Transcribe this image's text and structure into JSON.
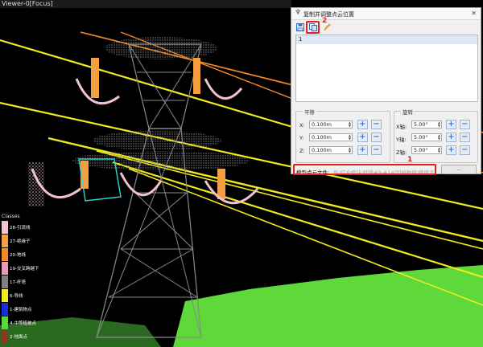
{
  "viewer": {
    "title": "Viewer-0[Focus]"
  },
  "legend": {
    "title": "Classes",
    "items": [
      {
        "label": "28-引流线",
        "color": "#f2c2d0"
      },
      {
        "label": "27-绝缘子",
        "color": "#f5a040"
      },
      {
        "label": "20-地线",
        "color": "#f58a2a"
      },
      {
        "label": "19-交叉跨越下",
        "color": "#e89ab8"
      },
      {
        "label": "17-杆塔",
        "color": "#808080"
      },
      {
        "label": "6-导线",
        "color": "#f0ea20"
      },
      {
        "label": "1-建筑物点",
        "color": "#1a2ed8"
      },
      {
        "label": "4-中等植被点",
        "color": "#58d838"
      },
      {
        "label": "2-地面点",
        "color": "#8a3a1a"
      }
    ]
  },
  "dialog": {
    "title": "复制并调整点云位置",
    "close_glyph": "✕",
    "toolbar": {
      "save_icon": "save-icon",
      "copy_icon": "copy-icon",
      "brush_icon": "brush-icon"
    },
    "annotations": {
      "one": "1",
      "two": "2"
    },
    "list": {
      "items": [
        "1"
      ]
    },
    "translate": {
      "title": "平移",
      "x_label": "X:",
      "x_value": "0.100m",
      "y_label": "Y:",
      "y_value": "0.100m",
      "z_label": "Z:",
      "z_value": "0.100m"
    },
    "rotate": {
      "title": "旋转",
      "x_label": "X轴:",
      "x_value": "5.00°",
      "y_label": "Y轴:",
      "y_value": "5.00°",
      "z_label": "Z轴:",
      "z_value": "5.00°"
    },
    "path": {
      "label": "模型点云文件:",
      "value": "件/综合模块/杆塔#9-#14/切档数据/绝缘子.LiData",
      "browse_label": "..."
    },
    "colors": {
      "highlight": "#e02020",
      "accent": "#3b7ad8"
    }
  }
}
